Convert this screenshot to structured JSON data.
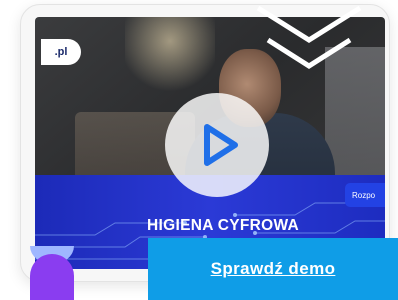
{
  "video": {
    "logo_text": ".pl",
    "side_label": "Rozpo",
    "title": "HIGIENA CYFROWA"
  },
  "cta": {
    "label": "Sprawdź demo"
  },
  "icons": {
    "play": "play-icon",
    "decor": "chevron-arrows-icon",
    "brand": "brand-shapes-icon"
  },
  "colors": {
    "play_blue": "#1f6fe8",
    "band_blue": "#1c2ab8",
    "cta_blue": "#0f9de7",
    "brand_light": "#9fb7ff",
    "brand_purple": "#8a3df0"
  }
}
